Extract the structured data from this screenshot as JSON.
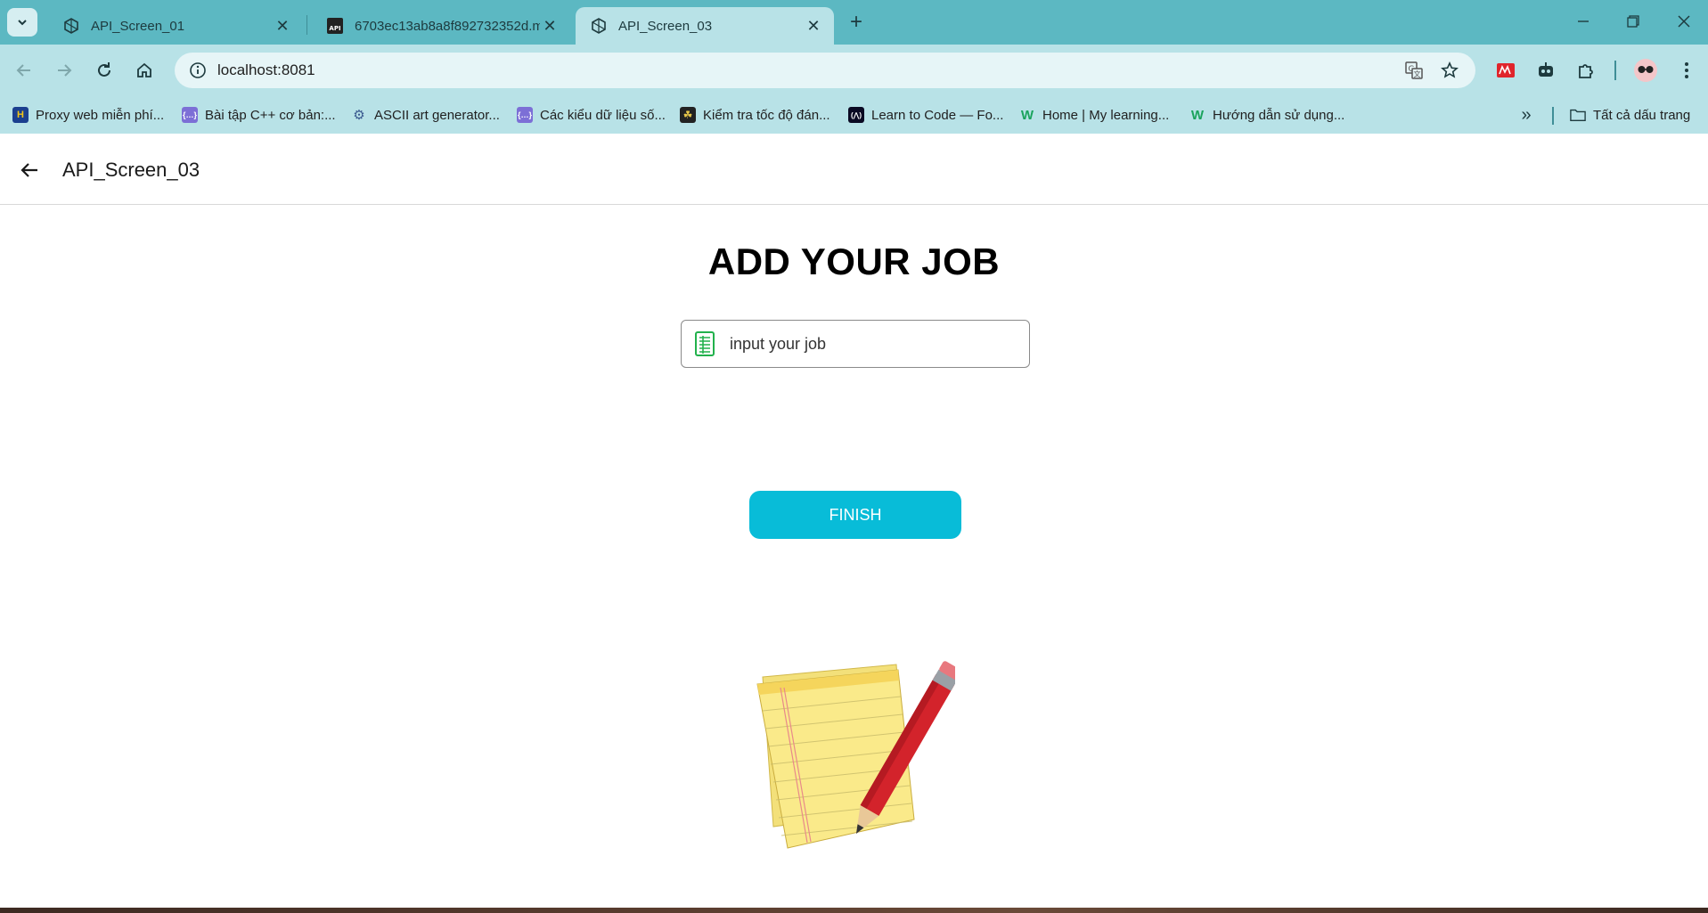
{
  "browser": {
    "tabs": [
      {
        "title": "API_Screen_01",
        "active": false,
        "icon": "expo-icon"
      },
      {
        "title": "6703ec13ab8a8f892732352d.m",
        "active": false,
        "icon": "mock-api-icon"
      },
      {
        "title": "API_Screen_03",
        "active": true,
        "icon": "expo-icon"
      }
    ],
    "url": "localhost:8081",
    "bookmarks": [
      {
        "label": "Proxy web miễn phí...",
        "icon": "H"
      },
      {
        "label": "Bài tập C++ cơ bản:...",
        "icon": "{…}"
      },
      {
        "label": "ASCII art generator...",
        "icon": "⚙"
      },
      {
        "label": "Các kiểu dữ liệu số...",
        "icon": "{…}"
      },
      {
        "label": "Kiểm tra tốc độ đán...",
        "icon": "☘"
      },
      {
        "label": "Learn to Code — Fo...",
        "icon": "(⋀)"
      },
      {
        "label": "Home | My learning...",
        "icon": "W"
      },
      {
        "label": "Hướng dẫn sử dụng...",
        "icon": "W"
      }
    ],
    "all_bookmarks_label": "Tất cả dấu trang"
  },
  "app": {
    "header_title": "API_Screen_03",
    "page_title": "ADD YOUR JOB",
    "job_input": {
      "placeholder": "input your job",
      "value": ""
    },
    "finish_label": "FINISH"
  },
  "colors": {
    "tabstrip": "#5cb8c2",
    "toolbar": "#b8e2e7",
    "finish_button": "#08bcd8"
  }
}
